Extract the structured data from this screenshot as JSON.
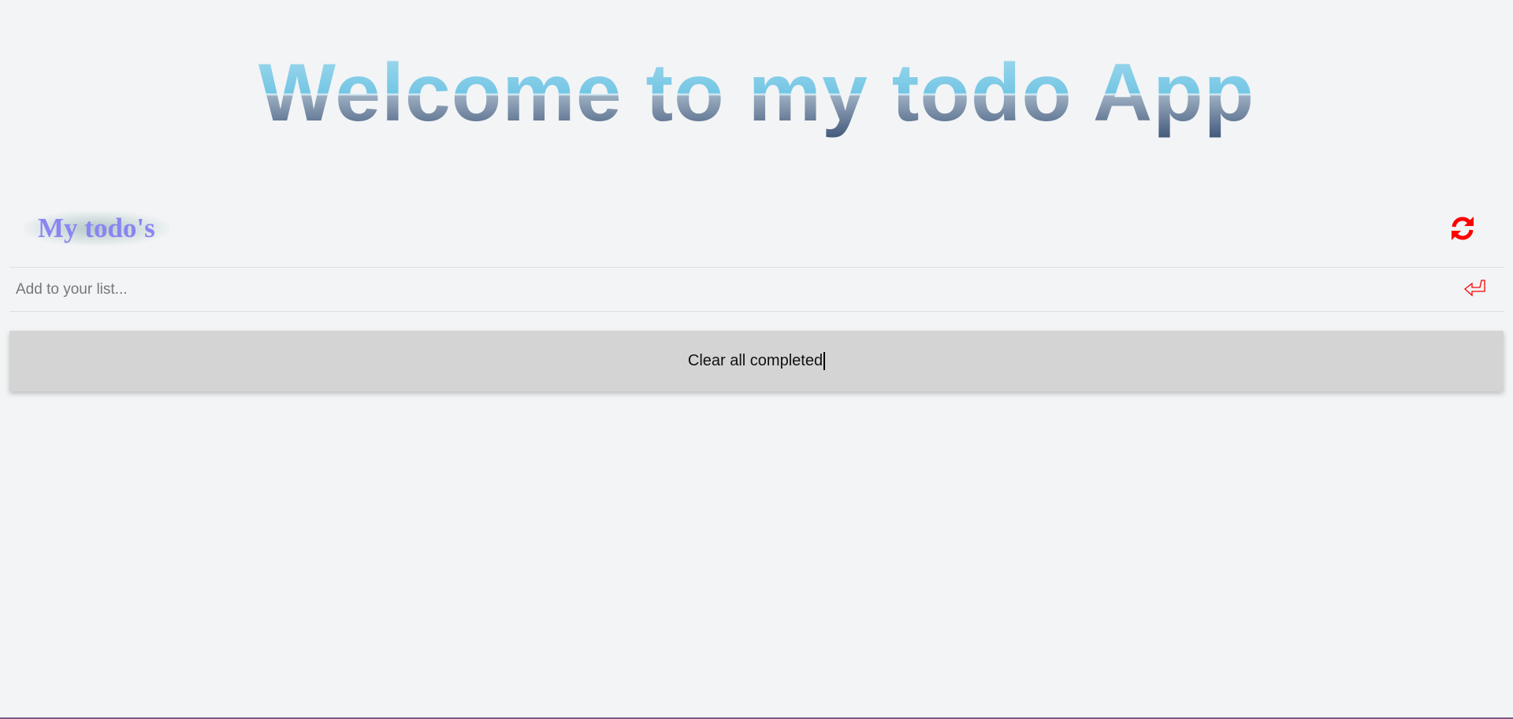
{
  "app": {
    "title": "Welcome to my todo App"
  },
  "list": {
    "title": "My todo's",
    "refresh_icon": "refresh-icon",
    "input_placeholder": "Add to your list...",
    "input_value": "",
    "enter_icon": "enter-return-icon",
    "clear_label": "Clear all completed"
  },
  "colors": {
    "background": "#f2f4f6",
    "icon_accent": "#ff0000",
    "list_title": "#8a84f2",
    "button_bg": "#d4d4d4"
  }
}
